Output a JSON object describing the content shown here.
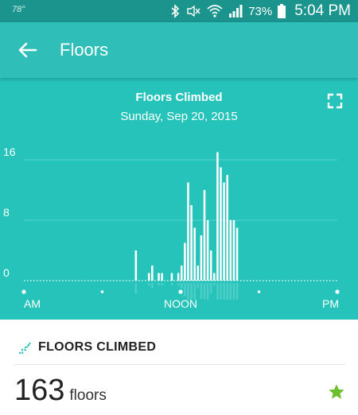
{
  "status_bar": {
    "temperature": "78°",
    "battery": "73%",
    "time": "5:04 PM",
    "icons": [
      "bluetooth-icon",
      "mute-icon",
      "wifi-icon",
      "signal-icon",
      "battery-icon"
    ]
  },
  "app_bar": {
    "title": "Floors",
    "back_icon": "arrow-left-icon"
  },
  "chart": {
    "expand_icon": "fullscreen-icon"
  },
  "chart_data": {
    "type": "bar",
    "title": "Floors Climbed",
    "subtitle": "Sunday, Sep 20, 2015",
    "ylim": [
      0,
      17
    ],
    "yticks": [
      0,
      8,
      16
    ],
    "xticks": [
      "AM",
      "NOON",
      "PM"
    ],
    "grid": true,
    "interval_minutes": 15,
    "bars": [
      {
        "time": "08:30",
        "value": 4
      },
      {
        "time": "09:30",
        "value": 1
      },
      {
        "time": "09:45",
        "value": 2
      },
      {
        "time": "10:15",
        "value": 1
      },
      {
        "time": "10:30",
        "value": 1
      },
      {
        "time": "11:15",
        "value": 1
      },
      {
        "time": "11:45",
        "value": 1
      },
      {
        "time": "12:00",
        "value": 2
      },
      {
        "time": "12:15",
        "value": 5
      },
      {
        "time": "12:30",
        "value": 13
      },
      {
        "time": "12:45",
        "value": 10
      },
      {
        "time": "13:00",
        "value": 7
      },
      {
        "time": "13:15",
        "value": 2
      },
      {
        "time": "13:30",
        "value": 6
      },
      {
        "time": "13:45",
        "value": 12
      },
      {
        "time": "14:00",
        "value": 8
      },
      {
        "time": "14:15",
        "value": 4
      },
      {
        "time": "14:30",
        "value": 1
      },
      {
        "time": "14:45",
        "value": 17
      },
      {
        "time": "15:00",
        "value": 15
      },
      {
        "time": "15:15",
        "value": 13
      },
      {
        "time": "15:30",
        "value": 14
      },
      {
        "time": "15:45",
        "value": 8
      },
      {
        "time": "16:00",
        "value": 8
      },
      {
        "time": "16:15",
        "value": 7
      }
    ],
    "colors": {
      "background": "#26c3bb",
      "bar": "#ffffff",
      "grid": "#5ad6cf"
    }
  },
  "stats": {
    "icon": "stairs-icon",
    "label": "FLOORS CLIMBED",
    "value": "163",
    "unit": "floors",
    "goal_icon": "star-icon",
    "goal_color": "#6bbf2a"
  }
}
